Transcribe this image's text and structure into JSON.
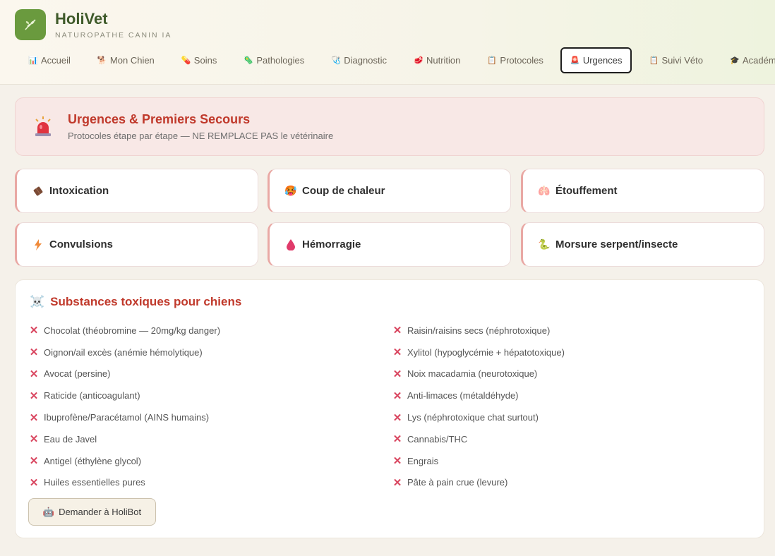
{
  "brand": {
    "title": "HoliVet",
    "subtitle": "NATUROPATHE CANIN IA"
  },
  "nav": [
    {
      "label": "Accueil",
      "icon": "bar-chart-icon"
    },
    {
      "label": "Mon Chien",
      "icon": "paw-icon"
    },
    {
      "label": "Soins",
      "icon": "pill-icon"
    },
    {
      "label": "Pathologies",
      "icon": "microbe-icon"
    },
    {
      "label": "Diagnostic",
      "icon": "stethoscope-icon"
    },
    {
      "label": "Nutrition",
      "icon": "meat-icon"
    },
    {
      "label": "Protocoles",
      "icon": "clipboard-icon"
    },
    {
      "label": "Urgences",
      "icon": "siren-icon",
      "active": true
    },
    {
      "label": "Suivi Véto",
      "icon": "clipboard-icon"
    },
    {
      "label": "Académie",
      "icon": "graduation-cap-icon"
    }
  ],
  "banner": {
    "title": "Urgences & Premiers Secours",
    "subtitle": "Protocoles étape par étape — NE REMPLACE PAS le vétérinaire"
  },
  "cards": [
    {
      "label": "Intoxication",
      "icon": "chocolate-icon"
    },
    {
      "label": "Coup de chaleur",
      "icon": "hot-face-icon"
    },
    {
      "label": "Étouffement",
      "icon": "lungs-icon"
    },
    {
      "label": "Convulsions",
      "icon": "lightning-icon"
    },
    {
      "label": "Hémorragie",
      "icon": "blood-drop-icon"
    },
    {
      "label": "Morsure serpent/insecte",
      "icon": "snake-icon"
    }
  ],
  "toxic": {
    "title": "Substances toxiques pour chiens",
    "left": [
      "Chocolat (théobromine — 20mg/kg danger)",
      "Oignon/ail excès (anémie hémolytique)",
      "Avocat (persine)",
      "Raticide (anticoagulant)",
      "Ibuprofène/Paracétamol (AINS humains)",
      "Eau de Javel",
      "Antigel (éthylène glycol)",
      "Huiles essentielles pures"
    ],
    "right": [
      "Raisin/raisins secs (néphrotoxique)",
      "Xylitol (hypoglycémie + hépatotoxique)",
      "Noix macadamia (neurotoxique)",
      "Anti-limaces (métaldéhyde)",
      "Lys (néphrotoxique chat surtout)",
      "Cannabis/THC",
      "Engrais",
      "Pâte à pain crue (levure)"
    ],
    "ask_button": "Demander à HoliBot"
  },
  "colors": {
    "accent_red": "#c0392b",
    "brand_green": "#6a9a3e",
    "x_mark": "#d9455f"
  }
}
